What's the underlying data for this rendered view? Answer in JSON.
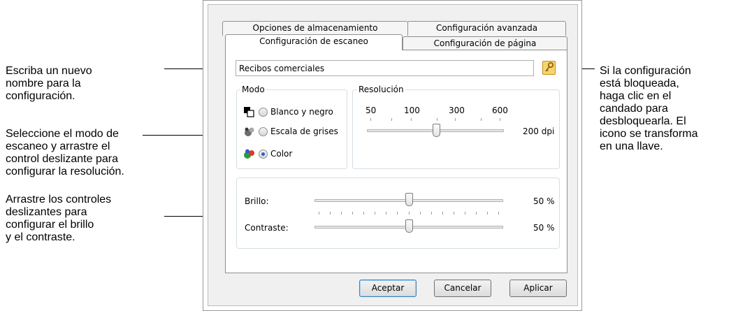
{
  "callouts": {
    "name": [
      "Escriba un nuevo",
      "nombre para la",
      "configuración."
    ],
    "mode": [
      "Seleccione el modo de",
      "escaneo y arrastre el",
      "control deslizante para",
      "configurar la resolución."
    ],
    "brightness": [
      "Arrastre los controles",
      "deslizantes para",
      "configurar el brillo",
      "y el contraste."
    ],
    "lock": [
      "Si la configuración",
      "está bloqueada,",
      "haga clic en el",
      "candado para",
      "desbloquearla. El",
      "icono se transforma",
      "en una llave."
    ]
  },
  "tabs": {
    "storage": "Opciones de almacenamiento",
    "advanced": "Configuración avanzada",
    "scan": "Configuración de escaneo",
    "page": "Configuración de página"
  },
  "settings_name": "Recibos comerciales",
  "mode": {
    "legend": "Modo",
    "options": [
      "Blanco y negro",
      "Escala de grises",
      "Color"
    ],
    "selected": "Color"
  },
  "resolution": {
    "legend": "Resolución",
    "scale_labels": [
      "50",
      "100",
      "300",
      "600"
    ],
    "value": 200,
    "value_label": "200 dpi"
  },
  "brightness": {
    "label": "Brillo:",
    "value": 50,
    "value_label": "50 %"
  },
  "contrast": {
    "label": "Contraste:",
    "value": 50,
    "value_label": "50 %"
  },
  "buttons": {
    "ok": "Aceptar",
    "cancel": "Cancelar",
    "apply": "Aplicar"
  },
  "icons": {
    "lock": "lock-icon",
    "mode_bw": "black-white-icon",
    "mode_gray": "grayscale-icon",
    "mode_color": "color-icon"
  },
  "colors": {
    "accent": "#3c7fb1",
    "lock": "#f6d46d"
  }
}
